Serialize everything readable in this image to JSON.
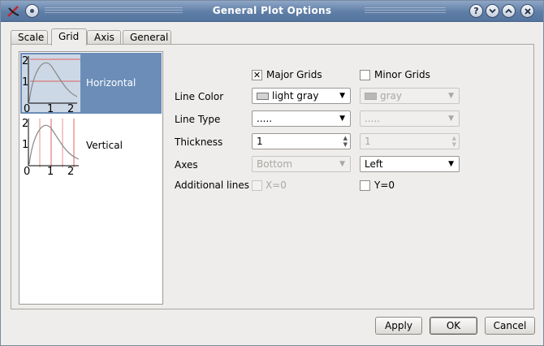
{
  "window": {
    "title": "General Plot Options"
  },
  "tabs": [
    {
      "label": "Scale"
    },
    {
      "label": "Grid"
    },
    {
      "label": "Axis"
    },
    {
      "label": "General"
    }
  ],
  "active_tab": "Grid",
  "grid_list": [
    {
      "label": "Horizontal",
      "selected": true,
      "y_ticks": [
        "2",
        "1"
      ],
      "x_ticks": [
        "0",
        "1",
        "2"
      ]
    },
    {
      "label": "Vertical",
      "selected": false,
      "y_ticks": [
        "2",
        "1"
      ],
      "x_ticks": [
        "0",
        "1",
        "2"
      ]
    }
  ],
  "form": {
    "major_grids": {
      "label": "Major Grids",
      "checked": true
    },
    "minor_grids": {
      "label": "Minor Grids",
      "checked": false
    },
    "line_color_label": "Line Color",
    "line_color_major": {
      "value": "light gray",
      "swatch": "#d3d3d3"
    },
    "line_color_minor": {
      "value": "gray",
      "swatch": "#b8b8b8"
    },
    "line_type_label": "Line Type",
    "line_type_major": ".....",
    "line_type_minor": ".....",
    "thickness_label": "Thickness",
    "thickness_major": "1",
    "thickness_minor": "1",
    "axes_label": "Axes",
    "axes_major": "Bottom",
    "axes_minor": "Left",
    "additional_lines_label": "Additional lines",
    "x0": {
      "label": "X=0",
      "checked": false
    },
    "y0": {
      "label": "Y=0",
      "checked": false
    }
  },
  "buttons": {
    "apply": "Apply",
    "ok": "OK",
    "cancel": "Cancel"
  },
  "colors": {
    "titlebar": "#5f7ea6",
    "selection": "#6b8db8",
    "grid_line": "#e06060"
  }
}
